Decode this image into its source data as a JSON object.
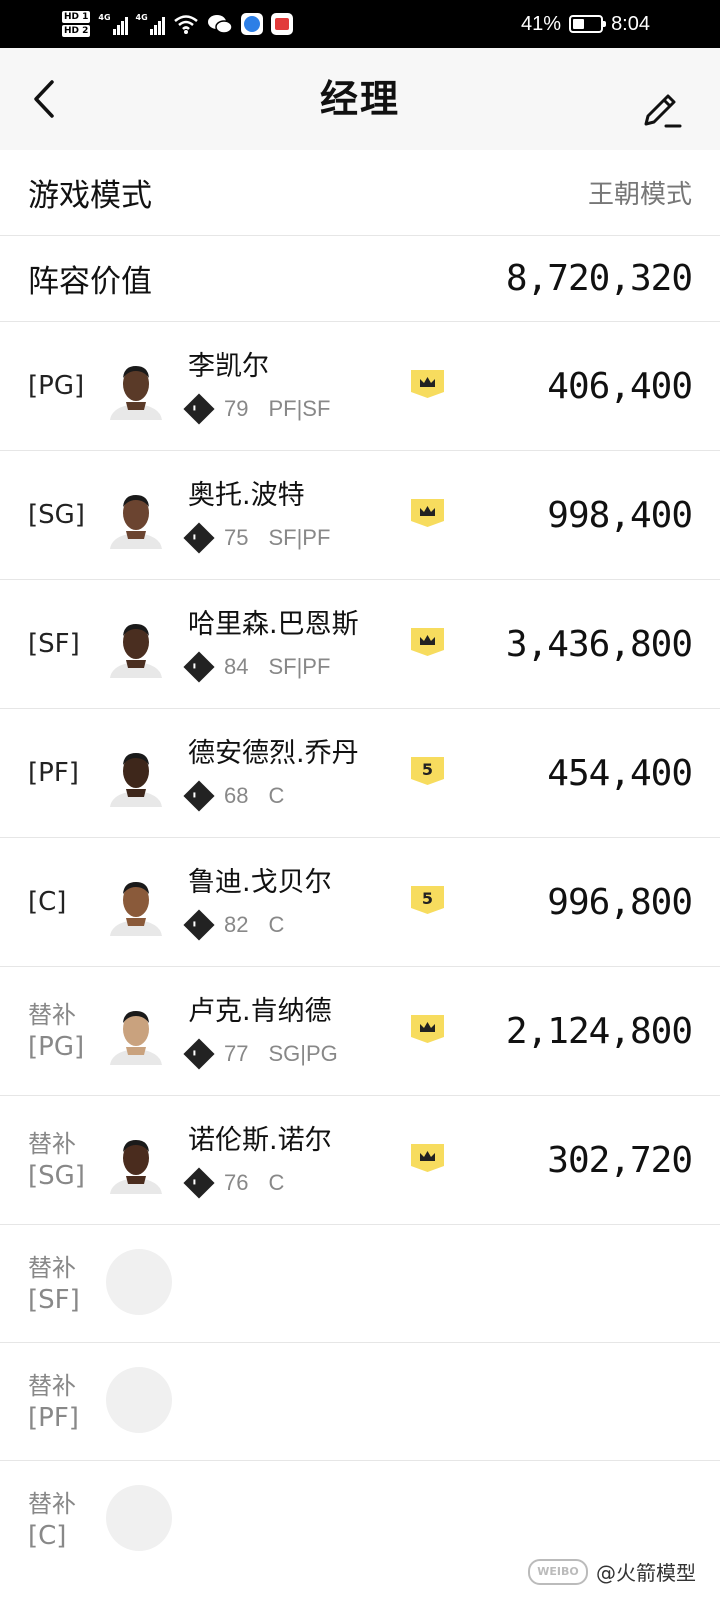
{
  "status_bar": {
    "hd1": "HD 1",
    "hd2": "HD 2",
    "net1": "4G",
    "net2": "4G",
    "battery_percent": "41%",
    "battery_level": 0.41,
    "time": "8:04"
  },
  "header": {
    "title": "经理",
    "back_icon": "chevron-left-icon",
    "edit_icon": "edit-pencil-icon"
  },
  "game_mode": {
    "label": "游戏模式",
    "value": "王朝模式"
  },
  "lineup_value": {
    "label": "阵容价值",
    "value": "8,720,320"
  },
  "players": [
    {
      "position": "[PG]",
      "bench": "",
      "name": "李凯尔",
      "rating": "79",
      "positions": "PF|SF",
      "badge": "crown",
      "badge_text": "",
      "value": "406,400",
      "skin": "#5a3a28"
    },
    {
      "position": "[SG]",
      "bench": "",
      "name": "奥托.波特",
      "rating": "75",
      "positions": "SF|PF",
      "badge": "crown",
      "badge_text": "",
      "value": "998,400",
      "skin": "#6b4430"
    },
    {
      "position": "[SF]",
      "bench": "",
      "name": "哈里森.巴恩斯",
      "rating": "84",
      "positions": "SF|PF",
      "badge": "crown",
      "badge_text": "",
      "value": "3,436,800",
      "skin": "#4a2e20"
    },
    {
      "position": "[PF]",
      "bench": "",
      "name": "德安德烈.乔丹",
      "rating": "68",
      "positions": "C",
      "badge": "number",
      "badge_text": "5",
      "value": "454,400",
      "skin": "#3e271b"
    },
    {
      "position": "[C]",
      "bench": "",
      "name": "鲁迪.戈贝尔",
      "rating": "82",
      "positions": "C",
      "badge": "number",
      "badge_text": "5",
      "value": "996,800",
      "skin": "#8a5a3a"
    },
    {
      "position": "[PG]",
      "bench": "替补",
      "name": "卢克.肯纳德",
      "rating": "77",
      "positions": "SG|PG",
      "badge": "crown",
      "badge_text": "",
      "value": "2,124,800",
      "skin": "#c9a27e"
    },
    {
      "position": "[SG]",
      "bench": "替补",
      "name": "诺伦斯.诺尔",
      "rating": "76",
      "positions": "C",
      "badge": "crown",
      "badge_text": "",
      "value": "302,720",
      "skin": "#4a2c1e"
    }
  ],
  "empty_slots": [
    {
      "bench": "替补",
      "position": "[SF]"
    },
    {
      "bench": "替补",
      "position": "[PF]"
    },
    {
      "bench": "替补",
      "position": "[C]"
    }
  ],
  "watermark": {
    "text": "@火箭模型"
  },
  "colors": {
    "badge_yellow": "#f7dc5e",
    "divider": "#e6e6e6",
    "header_bg": "#f7f7f7"
  }
}
